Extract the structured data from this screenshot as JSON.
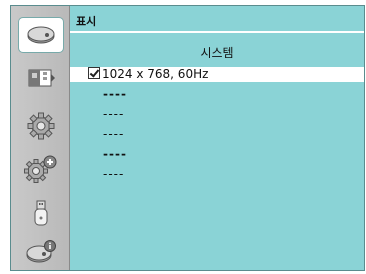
{
  "header": {
    "title": "표시"
  },
  "section": {
    "title": "시스템"
  },
  "options": [
    {
      "label": "1024 x 768, 60Hz",
      "selected": true,
      "checked": true
    },
    {
      "label": "----",
      "selected": false
    },
    {
      "label": "----",
      "selected": false
    },
    {
      "label": "----",
      "selected": false
    },
    {
      "label": "----",
      "selected": false
    },
    {
      "label": "----",
      "selected": false
    }
  ],
  "sidebar": {
    "items": [
      {
        "icon": "display-icon",
        "active": true
      },
      {
        "icon": "image-adjust-icon",
        "active": false
      },
      {
        "icon": "settings-gear-icon",
        "active": false
      },
      {
        "icon": "extended-settings-icon",
        "active": false
      },
      {
        "icon": "usb-icon",
        "active": false
      },
      {
        "icon": "info-icon",
        "active": false
      }
    ]
  },
  "colors": {
    "background": "#8ad3d6",
    "sidebar": "#c0c0c0",
    "highlight": "#ffffff"
  }
}
